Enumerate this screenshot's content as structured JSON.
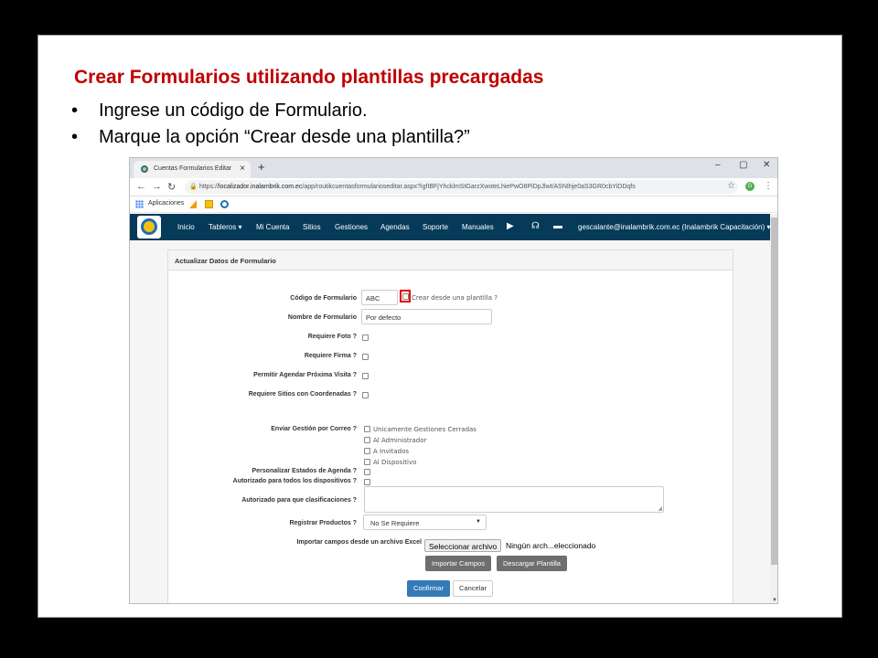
{
  "slide": {
    "title": "Crear Formularios utilizando plantillas precargadas",
    "bullets": [
      "Ingrese un código de Formulario.",
      "Marque la opción “Crear desde una plantilla?”"
    ],
    "bullet_glyph": "•"
  },
  "browser": {
    "tab_title": "Cuentas Formularios Editar",
    "tab_close": "×",
    "new_tab": "+",
    "window_controls": [
      "–",
      "▢",
      "✕"
    ],
    "url_host": "localizador.inalambrik.com.ec",
    "url_prefix": "https://",
    "url_path": "/app/routikcuentasformularioseditar.aspx?igfIBFjYhcklmStGarzXwoteLhiePwO8PiDpJlwt/ASNIhje0aS3GR0cbYiDDqfs",
    "bookmarks_label": "Aplicaciones"
  },
  "nav": {
    "items": [
      "Inicio",
      "Tableros ▾",
      "Mi Cuenta",
      "Sitios",
      "Gestiones",
      "Agendas",
      "Soporte",
      "Manuales"
    ],
    "user": "gescalante@inalambrik.com.ec (Inalambrik Capacitación) ▾",
    "icons": [
      "video-icon",
      "headset-icon",
      "chat-icon"
    ]
  },
  "form": {
    "panel_title": "Actualizar Datos de Formulario",
    "codigo_label": "Código de Formulario",
    "codigo_value": "ABC",
    "plantilla_label": "Crear desde una plantilla ?",
    "nombre_label": "Nombre de Formulario",
    "nombre_value": "Por defecto",
    "foto_label": "Requiere Foto ?",
    "firma_label": "Requiere Firma ?",
    "agendar_label": "Permitir Agendar Próxima Visita ?",
    "sitios_label": "Requiere Sitios con Coordenadas ?",
    "correo_label": "Enviar Gestión por Correo ?",
    "correo_options": [
      "Unicamente Gestiones Cerradas",
      "Al Administrador",
      "A Invitados",
      "Al Dispositivo"
    ],
    "estados_label": "Personalizar Estados de Agenda ?",
    "dispositivos_label": "Autorizado para todos los dispositivos ?",
    "clasificaciones_label": "Autorizado para que clasificaciones ?",
    "productos_label": "Registrar Productos ?",
    "productos_value": "No Se Requiere",
    "importar_label": "Importar campos desde un archivo Excel",
    "file_button": "Seleccionar archivo",
    "file_status": "Ningún arch...eleccionado",
    "importar_button": "Importar Campos",
    "descargar_button": "Descargar Plantilla",
    "confirmar_button": "Confirmar",
    "cancelar_button": "Cancelar"
  }
}
